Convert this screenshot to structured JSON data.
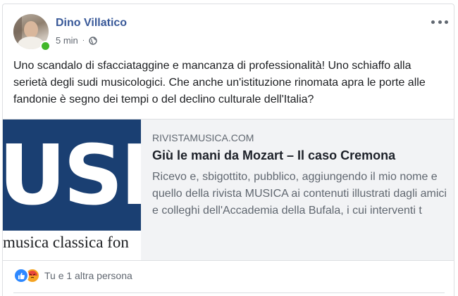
{
  "post": {
    "author": "Dino Villatico",
    "time": "5 min",
    "separator": "·",
    "privacy_icon": "globe-icon",
    "more_icon": "more-options-icon",
    "text": "Uno scandalo di sfacciataggine e mancanza di professionalità! Uno schiaffo alla serietà degli sudi musicologici. Che anche un'istituzione rinomata apra le porte alle fandonie è segno dei tempi o del declino culturale dell'Italia?"
  },
  "link_preview": {
    "thumbnail_text": "USIC",
    "thumbnail_subtext": "musica classica fon",
    "domain": "RIVISTAMUSICA.COM",
    "title": "Giù le mani da Mozart – Il caso Cremona",
    "description": "Ricevo e, sbigottito, pubblico, aggiungendo il mio nome e quello della rivista MUSICA ai contenuti illustrati dagli amici e colleghi dell'Accademia della Bufala, i cui interventi t"
  },
  "reactions": {
    "icons": [
      "like-icon",
      "angry-icon"
    ],
    "summary": "Tu e 1 altra persona"
  },
  "colors": {
    "author": "#385898",
    "online": "#42b72a",
    "like": "#2d88ff",
    "angry": "#f5a623",
    "thumb_band": "#1a3f72"
  }
}
